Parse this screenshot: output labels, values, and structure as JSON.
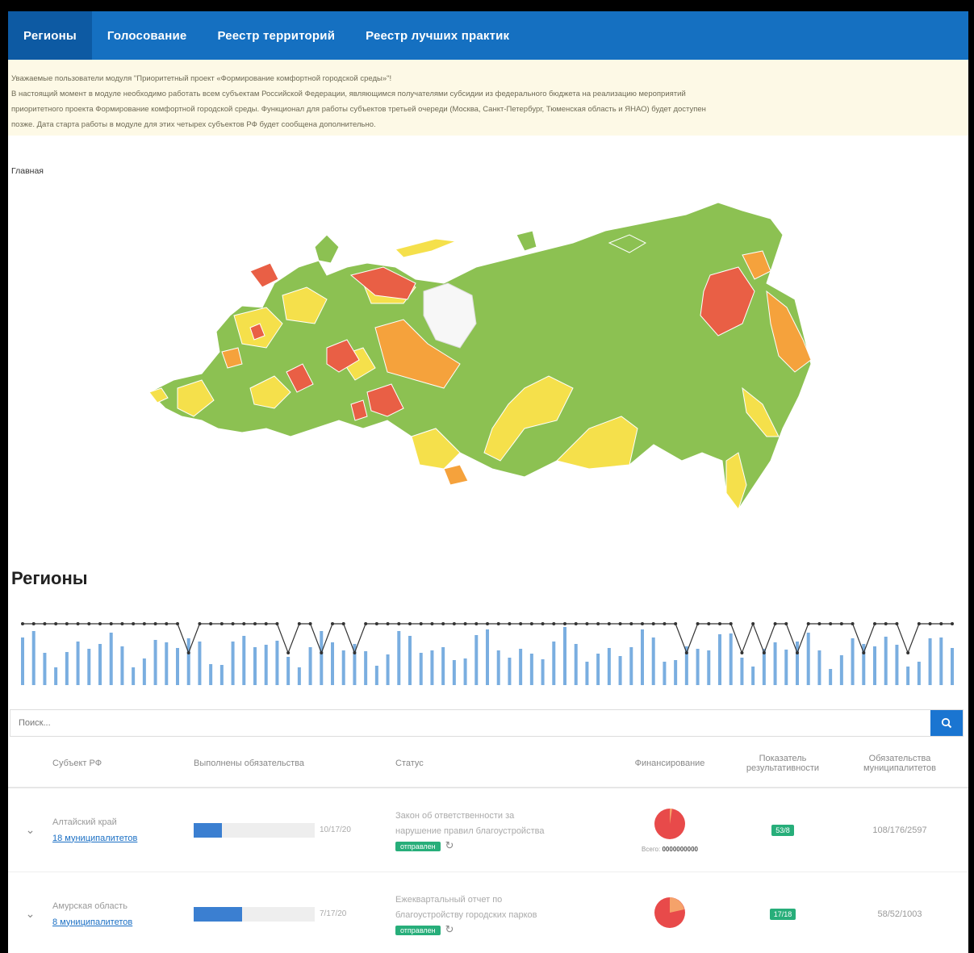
{
  "navbar": {
    "items": [
      {
        "label": "Регионы",
        "active": true
      },
      {
        "label": "Голосование",
        "active": false
      },
      {
        "label": "Реестр территорий",
        "active": false
      },
      {
        "label": "Реестр лучших практик",
        "active": false
      }
    ]
  },
  "notice": {
    "line1": "Уважаемые пользователи модуля \"Приоритетный проект «Формирование комфортной городской среды»\"!",
    "line2": "В настоящий момент в модуле необходимо работать всем субъектам Российской Федерации, являющимся получателями субсидии из федерального бюджета на реализацию мероприятий",
    "line3": "приоритетного проекта Формирование комфортной городской среды. Функционал для работы субъектов третьей очереди (Москва, Санкт-Петербург, Тюменская область и ЯНАО) будет доступен",
    "line4": "позже. Дата старта работы в модуле для этих четырех субъектов РФ будет сообщена дополнительно."
  },
  "breadcrumb": {
    "label": "Главная"
  },
  "map": {
    "colors": {
      "green": "#8cc152",
      "yellow": "#f5e04b",
      "orange": "#f5a23c",
      "red": "#e95f45",
      "white": "#f7f7f7"
    }
  },
  "regions_section": {
    "title": "Регионы"
  },
  "search": {
    "placeholder": "Поиск..."
  },
  "table": {
    "headers": {
      "subject": "Субъект РФ",
      "obligations": "Выполнены обязательства",
      "status": "Статус",
      "financing": "Финансирование",
      "indicator_line1": "Показатель",
      "indicator_line2": "результативности",
      "muni_line1": "Обязательства",
      "muni_line2": "муниципалитетов"
    },
    "rows": [
      {
        "region": "Алтайский край",
        "municipalities": "18 муниципалитетов",
        "progress": 0.23,
        "progress_label": "10/17/20",
        "status_line1": "Закон об ответственности за",
        "status_line2": "нарушение правил благоустройства",
        "status_badge": "отправлен",
        "fin_label": "Всего:",
        "fin_value": "0000000000",
        "indicator": "53/8",
        "muni_obligations": "108/176/2597"
      },
      {
        "region": "Амурская область",
        "municipalities": "8 муниципалитетов",
        "progress": 0.4,
        "progress_label": "7/17/20",
        "status_line1": "Ежеквартальный отчет по",
        "status_line2": "благоустройству городских парков",
        "status_badge": "отправлен",
        "fin_label": "",
        "fin_value": "",
        "indicator": "17/18",
        "muni_obligations": "58/52/1003"
      }
    ]
  }
}
